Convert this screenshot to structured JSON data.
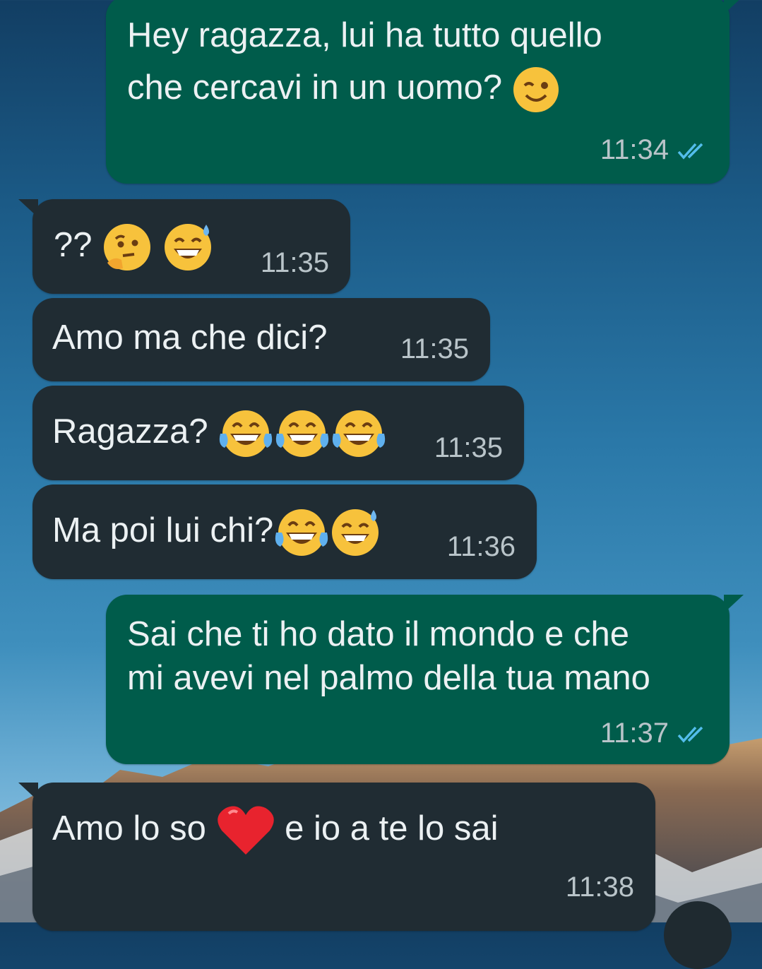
{
  "chat": {
    "messages": [
      {
        "direction": "outgoing",
        "line1": "Hey ragazza, lui ha tutto quello",
        "line2": "che cercavi in un uomo?",
        "emoji_icons": [
          "winking-face-icon"
        ],
        "time": "11:34",
        "status": "read-double-check-icon"
      },
      {
        "direction": "incoming",
        "text": "??",
        "emoji_icons": [
          "thinking-face-icon",
          "grinning-sweat-icon"
        ],
        "time": "11:35"
      },
      {
        "direction": "incoming",
        "text": "Amo ma che dici?",
        "time": "11:35"
      },
      {
        "direction": "incoming",
        "text": "Ragazza?",
        "emoji_icons": [
          "tears-of-joy-icon",
          "tears-of-joy-icon",
          "tears-of-joy-icon"
        ],
        "time": "11:35"
      },
      {
        "direction": "incoming",
        "text": "Ma poi lui chi?",
        "emoji_icons": [
          "tears-of-joy-icon",
          "grinning-sweat-icon"
        ],
        "time": "11:36"
      },
      {
        "direction": "outgoing",
        "line1": "Sai che ti ho dato il mondo e che",
        "line2": "mi avevi nel palmo della tua mano",
        "time": "11:37",
        "status": "read-double-check-icon"
      },
      {
        "direction": "incoming",
        "text_before": "Amo lo so",
        "text_after": "e io a te lo sai",
        "emoji_icons": [
          "red-heart-icon"
        ],
        "time": "11:38"
      }
    ]
  },
  "colors": {
    "outgoing_bubble": "#005c4b",
    "incoming_bubble": "#202c33",
    "text": "#ecf1f3",
    "timestamp": "#b9c4c9",
    "read_ticks": "#53bdeb"
  }
}
